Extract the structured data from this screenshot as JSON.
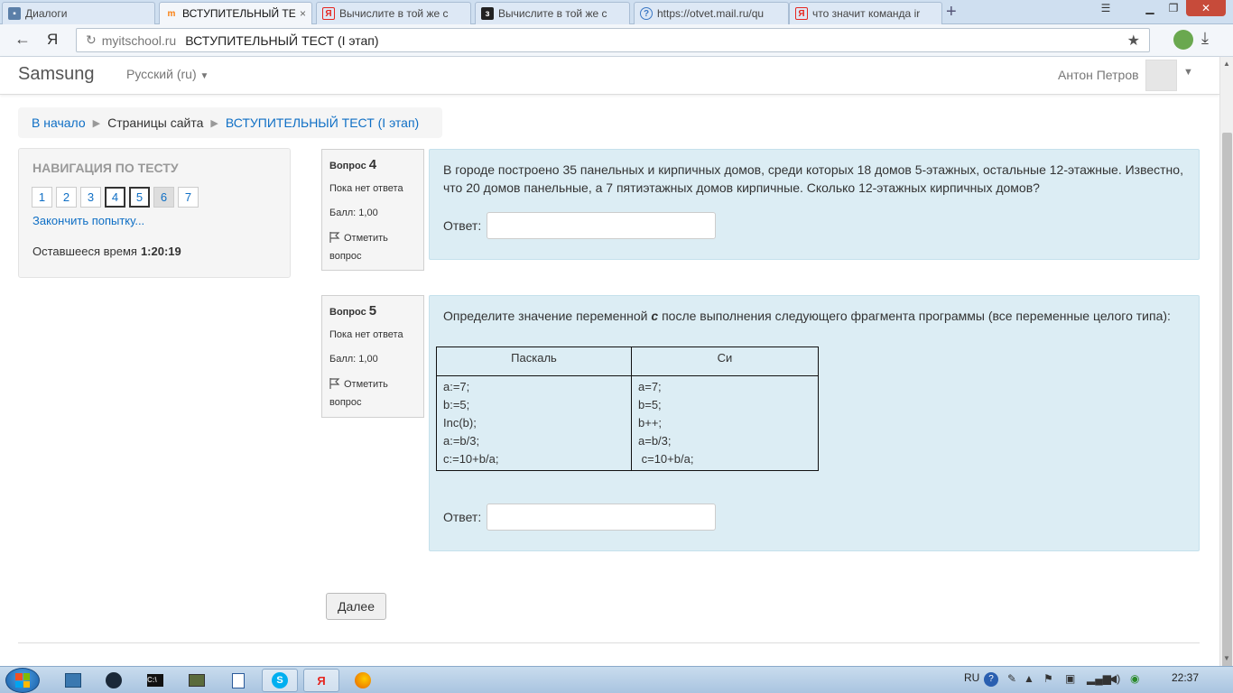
{
  "browser": {
    "tabs": [
      {
        "label": "Диалоги",
        "icon": "chat-icon",
        "active": false
      },
      {
        "label": "ВСТУПИТЕЛЬНЫЙ ТЕС",
        "icon": "moodle-icon",
        "active": true
      },
      {
        "label": "Вычислите в той же с",
        "icon": "yandex-icon",
        "active": false
      },
      {
        "label": "Вычислите в той же с",
        "icon": "znanija-icon",
        "active": false
      },
      {
        "label": "https://otvet.mail.ru/qu",
        "icon": "question-icon",
        "active": false
      },
      {
        "label": "что значит команда ir",
        "icon": "yandex-icon",
        "active": false
      }
    ],
    "tab_close": "×",
    "new_tab": "+",
    "url_host": "myitschool.ru",
    "url_title": "ВСТУПИТЕЛЬНЫЙ ТЕСТ (I этап)",
    "yandex_letter": "Я"
  },
  "header": {
    "brand": "Samsung",
    "language": "Русский (ru)",
    "username": "Антон Петров"
  },
  "breadcrumb": {
    "home": "В начало",
    "pages": "Страницы сайта",
    "current": "ВСТУПИТЕЛЬНЫЙ ТЕСТ (I этап)"
  },
  "quiz_nav": {
    "title": "НАВИГАЦИЯ ПО ТЕСТУ",
    "buttons": [
      "1",
      "2",
      "3",
      "4",
      "5",
      "6",
      "7"
    ],
    "current_buttons": [
      "4",
      "5"
    ],
    "viewed_buttons": [
      "6"
    ],
    "finish_link": "Закончить попытку...",
    "time_label": "Оставшееся время",
    "time_value": "1:20:19"
  },
  "questions": [
    {
      "label": "Вопрос",
      "number": "4",
      "state": "Пока нет ответа",
      "grade": "Балл: 1,00",
      "flag_label": "Отметить вопрос",
      "text": "В городе построено 35 панельных и кирпичных домов, среди которых 18 домов 5-этажных, остальные 12-этажные. Известно, что 20 домов панельные, а 7 пятиэтажных домов кирпичные. Сколько 12-этажных кирпичных домов?",
      "answer_label": "Ответ:",
      "answer_value": ""
    },
    {
      "label": "Вопрос",
      "number": "5",
      "state": "Пока нет ответа",
      "grade": "Балл: 1,00",
      "flag_label": "Отметить вопрос",
      "text_before": "Определите значение переменной ",
      "text_var": "c",
      "text_after": " после выполнения следующего фрагмента программы (все переменные целого типа):",
      "table": {
        "headers": [
          "Паскаль",
          "Си"
        ],
        "pascal": [
          "a:=7;",
          "b:=5;",
          "Inc(b);",
          "a:=b/3;",
          "c:=10+b/a;"
        ],
        "c": [
          "a=7;",
          "b=5;",
          "b++;",
          "a=b/3;",
          " c=10+b/a;"
        ]
      },
      "answer_label": "Ответ:",
      "answer_value": ""
    }
  ],
  "next_button": "Далее",
  "taskbar": {
    "lang": "RU",
    "clock": "22:37"
  }
}
